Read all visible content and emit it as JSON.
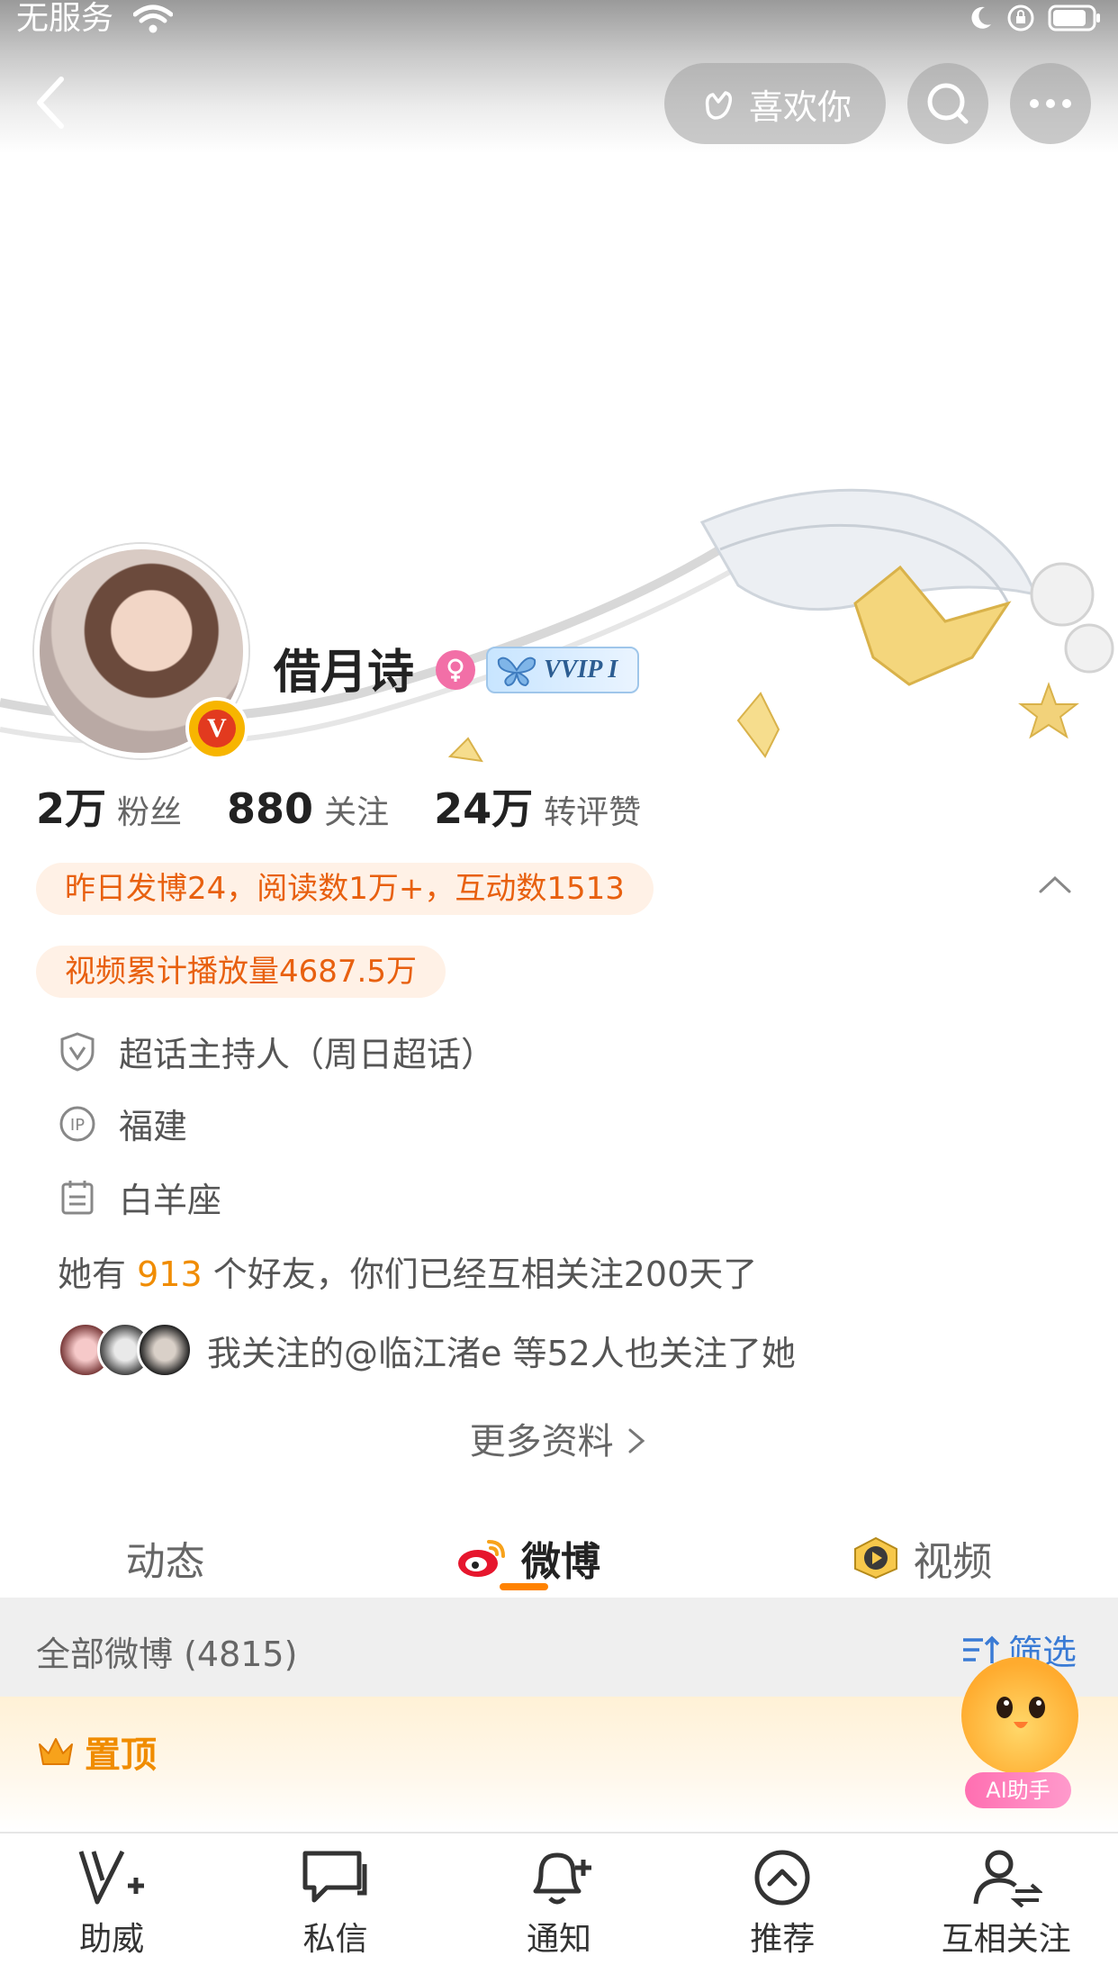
{
  "status_bar": {
    "carrier": "无服务"
  },
  "header": {
    "like_button": "喜欢你"
  },
  "profile": {
    "name": "借月诗",
    "vip_badge": "VVIP I",
    "stats": [
      {
        "value": "2万",
        "label": "粉丝"
      },
      {
        "value": "880",
        "label": "关注"
      },
      {
        "value": "24万",
        "label": "转评赞"
      }
    ],
    "highlights": [
      "昨日发博24，阅读数1万+，互动数1513",
      "视频累计播放量4687.5万"
    ],
    "info": [
      {
        "icon": "shield-v-icon",
        "text": "超话主持人（周日超话）"
      },
      {
        "icon": "ip-icon",
        "text": "福建"
      },
      {
        "icon": "calendar-icon",
        "text": "白羊座"
      }
    ],
    "friends": {
      "prefix": "她有",
      "count": "913",
      "suffix": "个好友，你们已经互相关注200天了"
    },
    "mutual_follow": "我关注的@临江渚e 等52人也关注了她",
    "more_info": "更多资料"
  },
  "tabs": [
    {
      "label": "动态",
      "active": false
    },
    {
      "label": "微博",
      "active": true
    },
    {
      "label": "视频",
      "active": false
    }
  ],
  "list": {
    "title": "全部微博 (4815)",
    "filter": "筛选",
    "pinned": "置顶"
  },
  "ai_helper": "AI助手",
  "bottom_bar": [
    {
      "label": "助威",
      "icon": "v-plus-icon"
    },
    {
      "label": "私信",
      "icon": "message-icon"
    },
    {
      "label": "通知",
      "icon": "bell-plus-icon"
    },
    {
      "label": "推荐",
      "icon": "chevron-up-circle-icon"
    },
    {
      "label": "互相关注",
      "icon": "mutual-follow-icon"
    }
  ],
  "colors": {
    "accent": "#ff8200",
    "highlight_bg": "#fff1e6",
    "highlight_text": "#e8600f",
    "link": "#3a7bd5"
  }
}
